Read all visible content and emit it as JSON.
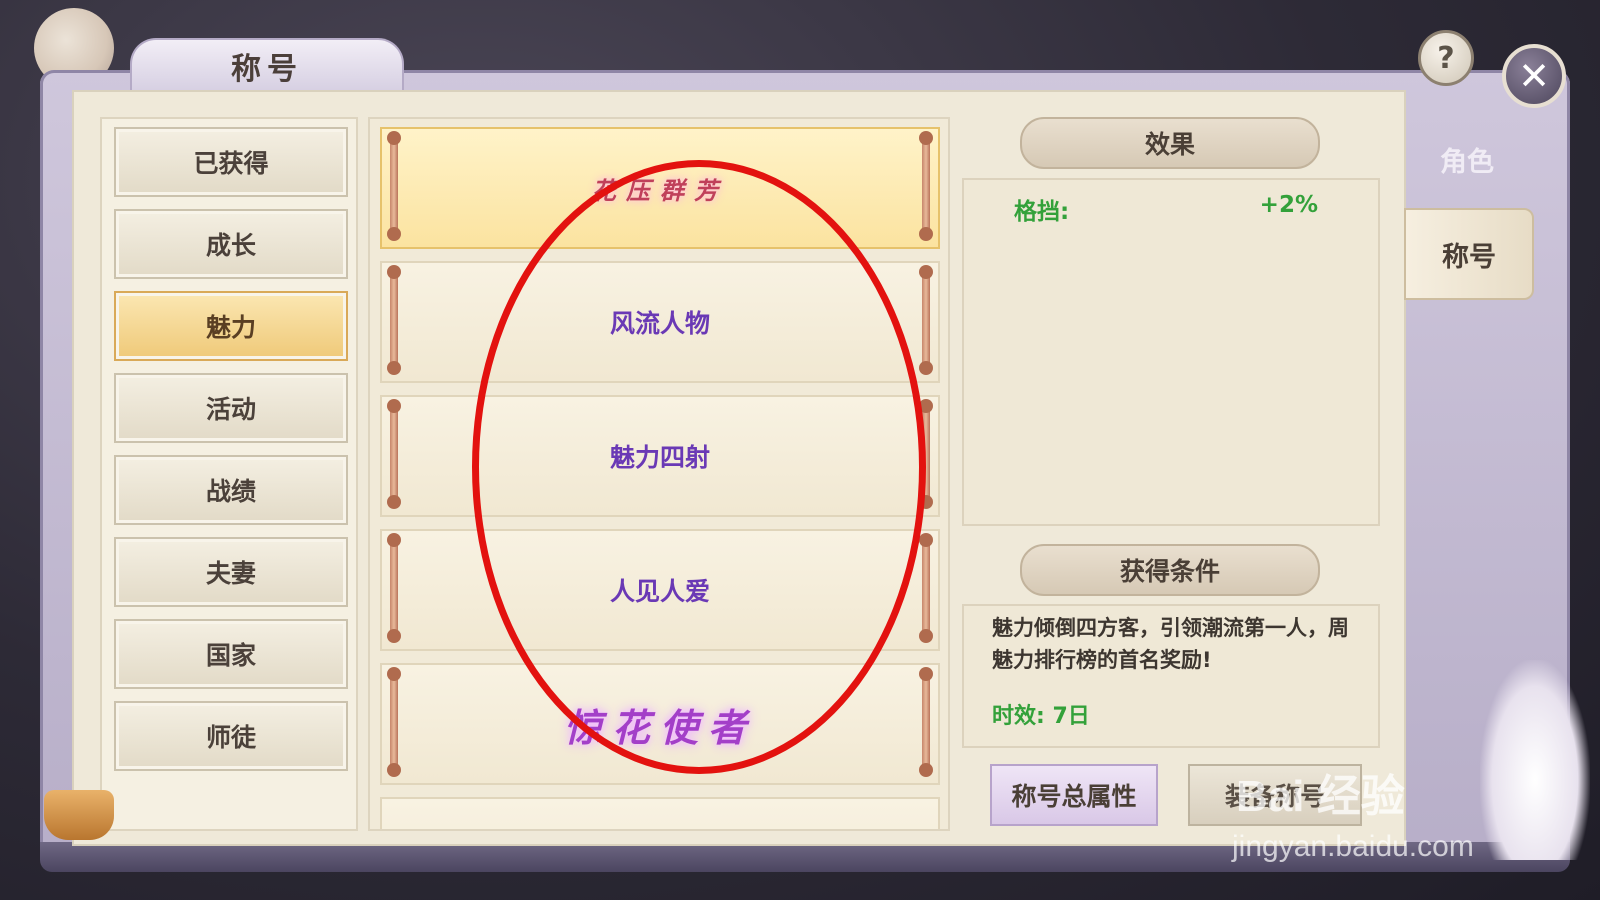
{
  "window": {
    "title": "称号"
  },
  "top_buttons": {
    "help": "?",
    "close": "✕"
  },
  "categories": [
    {
      "label": "已获得",
      "active": false
    },
    {
      "label": "成长",
      "active": false
    },
    {
      "label": "魅力",
      "active": true
    },
    {
      "label": "活动",
      "active": false
    },
    {
      "label": "战绩",
      "active": false
    },
    {
      "label": "夫妻",
      "active": false
    },
    {
      "label": "国家",
      "active": false
    },
    {
      "label": "师徒",
      "active": false
    }
  ],
  "titles": [
    {
      "label": "花压群芳",
      "style": "decorative",
      "selected": true
    },
    {
      "label": "风流人物",
      "style": "plain",
      "selected": false
    },
    {
      "label": "魅力四射",
      "style": "plain",
      "selected": false
    },
    {
      "label": "人见人爱",
      "style": "plain",
      "selected": false
    },
    {
      "label": "惊花使者",
      "style": "decorative",
      "selected": false
    }
  ],
  "effect": {
    "header": "效果",
    "stat_name": "格挡:",
    "stat_value": "+2%"
  },
  "condition": {
    "header": "获得条件",
    "description": "魅力倾倒四方客，引领潮流第一人，周魅力排行榜的首名奖励!",
    "duration": "时效: 7日"
  },
  "actions": {
    "total_attributes": "称号总属性",
    "equip": "装备称号"
  },
  "side_tabs": [
    {
      "label": "角色",
      "active": false
    },
    {
      "label": "称号",
      "active": true
    }
  ],
  "watermark": {
    "brand": "Bai 经验",
    "url": "jingyan.baidu.com"
  },
  "colors": {
    "annotation": "#e3120f",
    "title_text": "#6a39b5",
    "active_category": "#efc978",
    "effect_green": "#33a13a"
  }
}
